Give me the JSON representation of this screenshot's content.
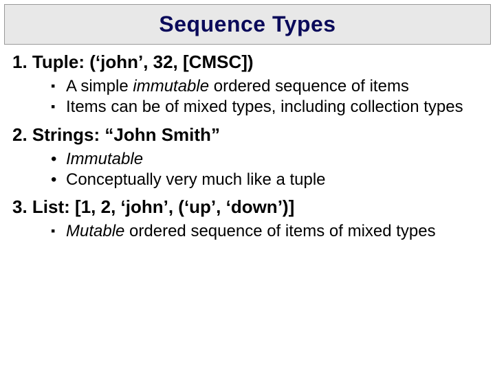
{
  "title": "Sequence Types",
  "sections": [
    {
      "head_num": "1.",
      "head_label": "Tuple:",
      "head_example": "(‘john’, 32, [CMSC])",
      "bullet_style": "square",
      "bullets": [
        {
          "pre": "A simple ",
          "em": "immutable",
          "post": " ordered sequence of items"
        },
        {
          "pre": "Items can be of mixed types, including collection types",
          "em": "",
          "post": ""
        }
      ]
    },
    {
      "head_num": "2.",
      "head_label": "Strings:",
      "head_example": "“John Smith”",
      "bullet_style": "dot",
      "bullets": [
        {
          "pre": "",
          "em": "Immutable",
          "post": ""
        },
        {
          "pre": "Conceptually very much like a tuple",
          "em": "",
          "post": ""
        }
      ]
    },
    {
      "head_num": "3.",
      "head_label": "List:",
      "head_example": "[1, 2, ‘john’, (‘up’, ‘down’)]",
      "bullet_style": "square",
      "bullets": [
        {
          "pre": "",
          "em": "Mutable",
          "post": " ordered sequence of items of mixed types"
        }
      ]
    }
  ]
}
